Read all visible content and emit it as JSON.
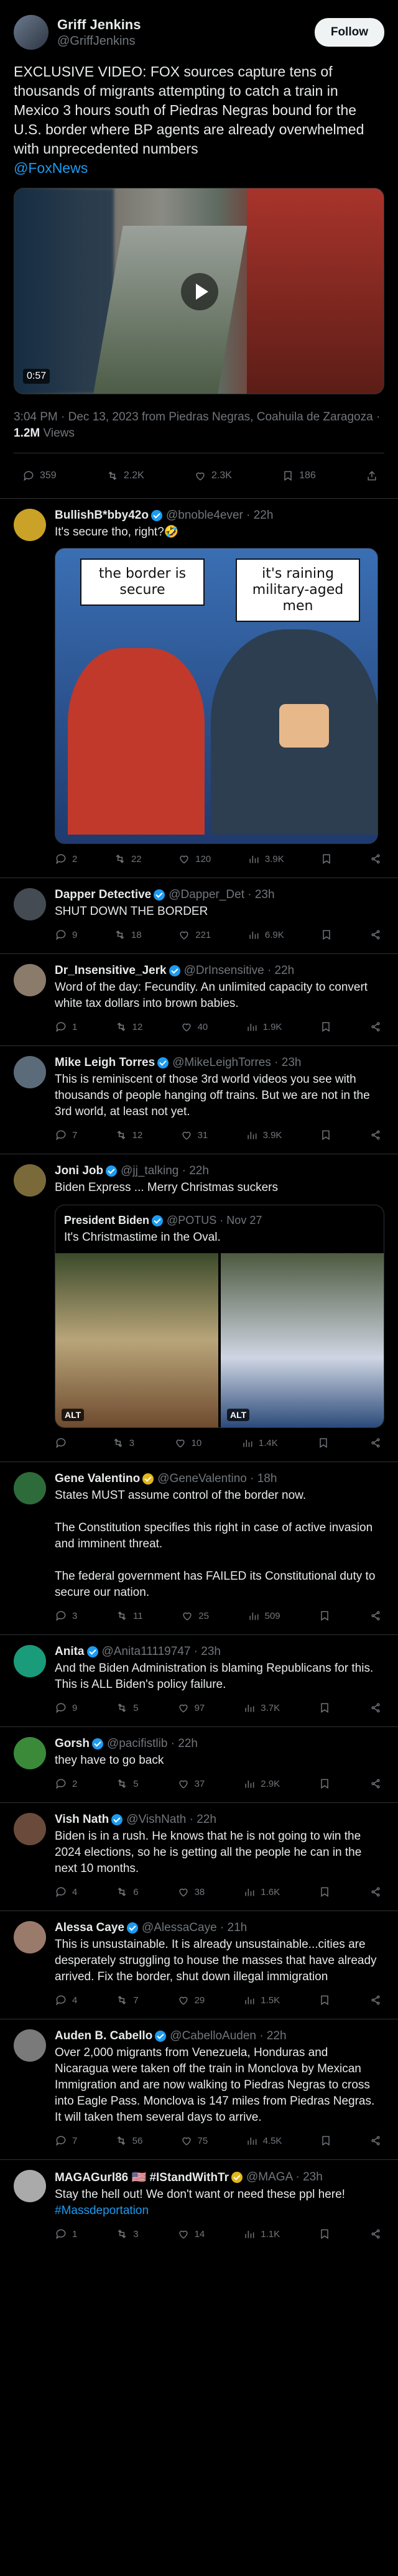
{
  "main": {
    "name": "Griff Jenkins",
    "handle": "@GriffJenkins",
    "follow_label": "Follow",
    "text": "EXCLUSIVE VIDEO: FOX sources capture tens of thousands of migrants attempting to catch a train in Mexico 3 hours south of Piedras Negras bound for the U.S. border where BP agents are already overwhelmed with unprecedented numbers",
    "mention": "@FoxNews",
    "video_duration": "0:57",
    "meta_time": "3:04 PM · Dec 13, 2023 from Piedras Negras, Coahuila de Zaragoza · ",
    "views": "1.2M",
    "views_label": " Views",
    "replies": "359",
    "reposts": "2.2K",
    "likes": "2.3K",
    "bookmarks": "186"
  },
  "replies": [
    {
      "name": "BullishB*bby42o",
      "handle": "@bnoble4ever · 22h",
      "text": "It's secure tho, right?🤣",
      "meme_left": "the border is secure",
      "meme_right": "it's raining military-aged men",
      "replies": "2",
      "reposts": "22",
      "likes": "120",
      "views": "3.9K",
      "avatar": "#c9a227"
    },
    {
      "name": "Dapper Detective",
      "handle": "@Dapper_Det · 23h",
      "text": "SHUT DOWN THE BORDER",
      "replies": "9",
      "reposts": "18",
      "likes": "221",
      "views": "6.9K",
      "avatar": "#444b52"
    },
    {
      "name": "Dr_Insensitive_Jerk",
      "handle": "@DrInsensitive · 22h",
      "text": "Word of the day: Fecundity. An unlimited capacity to convert white tax dollars into brown babies.",
      "replies": "1",
      "reposts": "12",
      "likes": "40",
      "views": "1.9K",
      "avatar": "#8a7b6a"
    },
    {
      "name": "Mike Leigh Torres",
      "handle": "@MikeLeighTorres · 23h",
      "text": "This is reminiscent of those 3rd world videos you see with thousands of people hanging off trains. But we are not in the 3rd world, at least not yet.",
      "replies": "7",
      "reposts": "12",
      "likes": "31",
      "views": "3.9K",
      "avatar": "#5b6b7a"
    },
    {
      "name": "Joni Job",
      "handle": "@jj_talking · 22h",
      "text": "Biden Express ... Merry Christmas suckers",
      "quote_name": "President Biden",
      "quote_handle": "@POTUS · Nov 27",
      "quote_text": "It's Christmastime in the Oval.",
      "alt1": "ALT",
      "alt2": "ALT",
      "replies": "",
      "reposts": "3",
      "likes": "10",
      "views": "1.4K",
      "avatar": "#7a6a3a"
    },
    {
      "name": "Gene Valentino",
      "handle": "@GeneValentino · 18h",
      "text": "States MUST assume control of the border now.\n\nThe Constitution specifies this right in case of active invasion and imminent threat.\n\nThe federal government has FAILED its Constitutional duty to secure our nation.",
      "replies": "3",
      "reposts": "11",
      "likes": "25",
      "views": "509",
      "avatar": "#2e6b3a"
    },
    {
      "name": "Anita",
      "handle": "@Anita11119747 · 23h",
      "text": "And the Biden Administration is blaming Republicans for this. This is ALL Biden's policy failure.",
      "replies": "9",
      "reposts": "5",
      "likes": "97",
      "views": "3.7K",
      "avatar": "#1a9b7a"
    },
    {
      "name": "Gorsh",
      "handle": "@pacifistlib · 22h",
      "text": "they have to go back",
      "replies": "2",
      "reposts": "5",
      "likes": "37",
      "views": "2.9K",
      "avatar": "#3a8a3a"
    },
    {
      "name": "Vish Nath",
      "handle": "@VishNath · 22h",
      "text": "Biden is in a rush. He knows that he is not going to win the 2024 elections, so he is getting all the people he can in the next 10 months.",
      "replies": "4",
      "reposts": "6",
      "likes": "38",
      "views": "1.6K",
      "avatar": "#6a4a3a"
    },
    {
      "name": "Alessa Caye",
      "handle": "@AlessaCaye · 21h",
      "text": "This is unsustainable. It is already unsustainable...cities are desperately struggling to house the masses that have already arrived. Fix the border, shut down illegal immigration",
      "replies": "4",
      "reposts": "7",
      "likes": "29",
      "views": "1.5K",
      "avatar": "#9a7a6a"
    },
    {
      "name": "Auden B. Cabello",
      "handle": "@CabelloAuden · 22h",
      "text": "Over 2,000 migrants from Venezuela, Honduras and Nicaragua were taken off the train in Monclova by Mexican Immigration and are now walking to Piedras Negras to cross into Eagle Pass. Monclova is 147 miles from Piedras Negras. It will taken them several days to arrive.",
      "replies": "7",
      "reposts": "56",
      "likes": "75",
      "views": "4.5K",
      "avatar": "#7a7a7a"
    },
    {
      "name": "MAGAGurl86 🇺🇸 #IStandWithTr",
      "handle": "@MAGA · 23h",
      "text": "Stay the hell out!  We don't want or need these ppl here! ",
      "hashtag": "#Massdeportation",
      "replies": "1",
      "reposts": "3",
      "likes": "14",
      "views": "1.1K",
      "avatar": "#aaaaaa"
    }
  ]
}
